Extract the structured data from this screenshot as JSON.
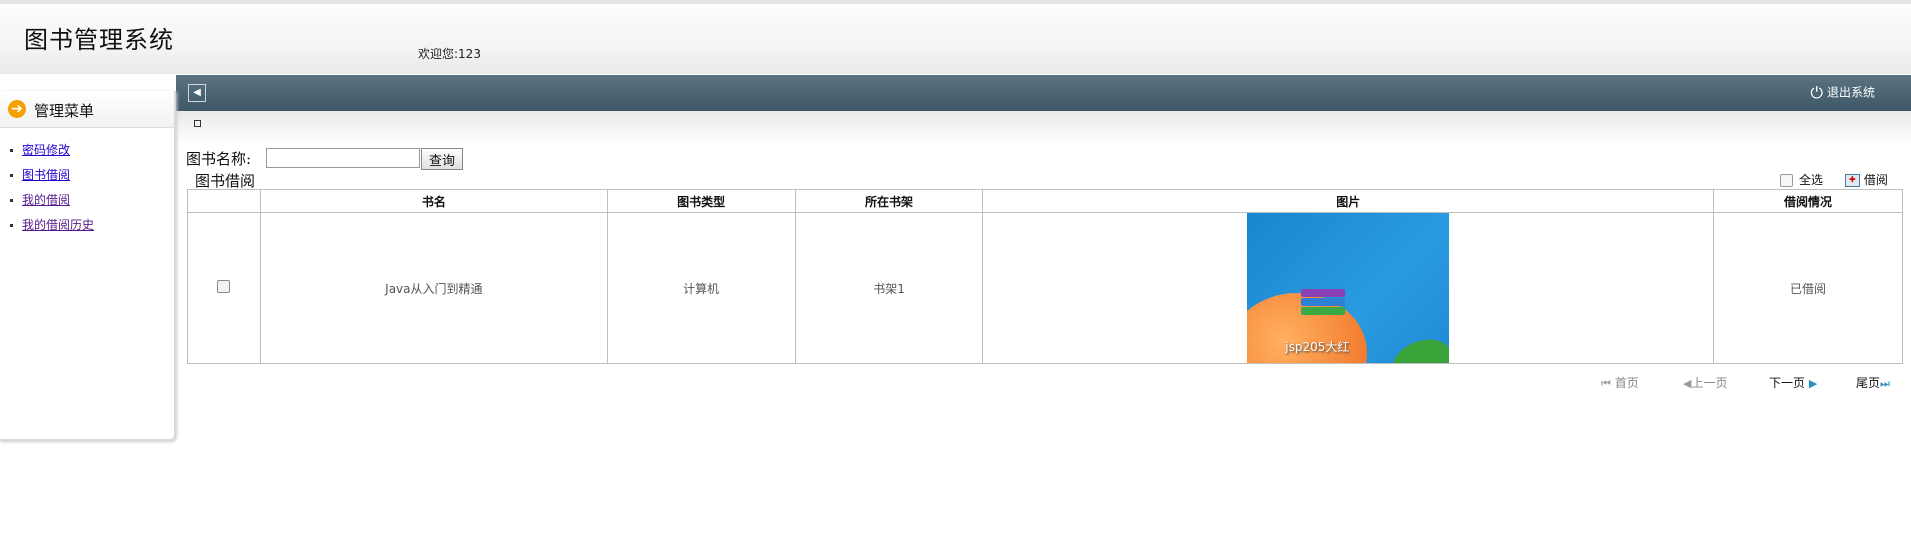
{
  "header": {
    "title": "图书管理系统",
    "welcome": "欢迎您:123"
  },
  "navbar": {
    "collapse_icon": "collapse-left-icon",
    "logout_label": "退出系统"
  },
  "sidebar": {
    "title": "管理菜单",
    "items": [
      {
        "label": "密码修改"
      },
      {
        "label": "图书借阅"
      },
      {
        "label": "我的借阅"
      },
      {
        "label": "我的借阅历史"
      }
    ]
  },
  "search": {
    "label": "图书名称:",
    "value": "",
    "button_label": "查询"
  },
  "section": {
    "title": "图书借阅",
    "select_all_label": "全选",
    "borrow_label": "借阅"
  },
  "table": {
    "columns": [
      "",
      "书名",
      "图书类型",
      "所在书架",
      "图片",
      "借阅情况"
    ],
    "rows": [
      {
        "checked": false,
        "name": "Java从入门到精通",
        "type": "计算机",
        "shelf": "书架1",
        "image_caption": "jsp205大红",
        "status": "已借阅"
      }
    ]
  },
  "pagination": {
    "first": "首页",
    "prev": "上一页",
    "next": "下一页",
    "last": "尾页"
  },
  "colors": {
    "navbar": "#4a6473",
    "menu_arrow": "#f5a000",
    "link": "#2200cc"
  }
}
